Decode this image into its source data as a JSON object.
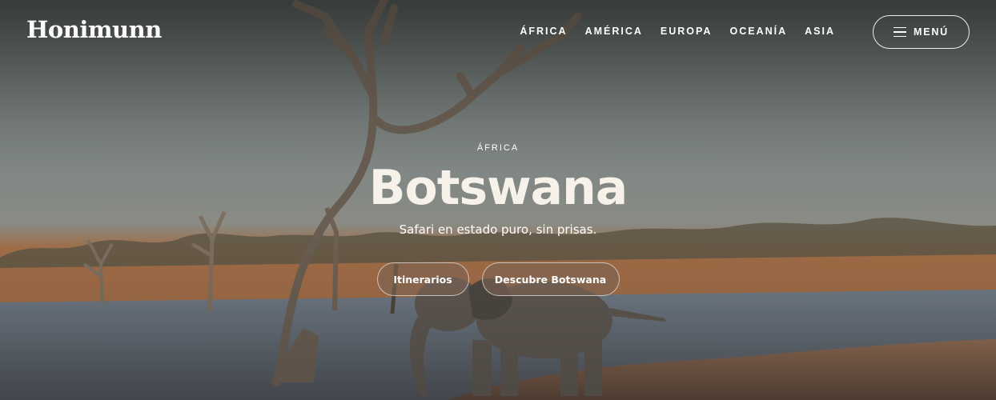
{
  "header": {
    "logo": "Honimunn",
    "nav": [
      "ÁFRICA",
      "AMÉRICA",
      "EUROPA",
      "OCEANÍA",
      "ASIA"
    ],
    "menu_label": "MENÚ",
    "menu_icon": "hamburger-icon"
  },
  "hero": {
    "kicker": "ÁFRICA",
    "title": "Botswana",
    "subtitle": "Safari en estado puro, sin prisas.",
    "buttons": [
      "Itinerarios",
      "Descubre Botswana"
    ]
  },
  "colors": {
    "text": "#ffffff",
    "button_bg": "#7d6452",
    "water": "#6d7680",
    "ground": "#9c6a45"
  }
}
